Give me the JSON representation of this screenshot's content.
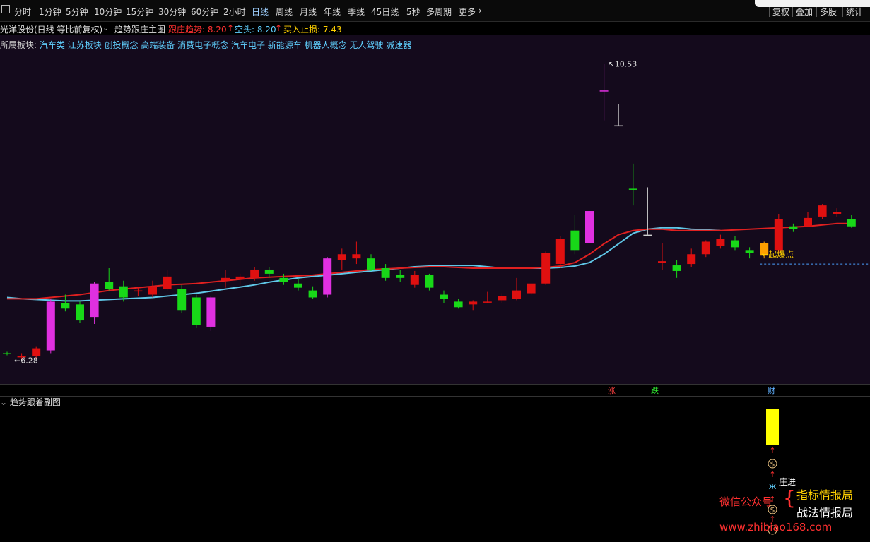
{
  "toolbar": {
    "items": [
      "分时",
      "1分钟",
      "5分钟",
      "10分钟",
      "15分钟",
      "30分钟",
      "60分钟",
      "2小时",
      "日线",
      "周线",
      "月线",
      "年线",
      "季线",
      "45日线",
      "5秒",
      "多周期",
      "更多"
    ],
    "active": "日线",
    "right": [
      "复权",
      "叠加",
      "多股",
      "统计"
    ]
  },
  "info": {
    "stock": "光洋股份(日线 等比前复权)",
    "indicator": "趋势跟庄主图",
    "trend_label": "跟庄趋势: 8.20",
    "short_label": "空头: 8.20",
    "stop_label": "买入止损: 7.43"
  },
  "sector": {
    "prefix": "所属板块:",
    "list": "汽车类 江苏板块 创投概念 高端装备 消费电子概念 汽车电子 新能源车 机器人概念 无人驾驶 减速器"
  },
  "annotations": {
    "high": "10.53",
    "low": "6.28",
    "breakout": "起爆点",
    "marker_up": "涨",
    "marker_down": "跌",
    "marker_cai": "财"
  },
  "sub": {
    "title": "趋势跟着副图",
    "zhuang": "庄进"
  },
  "watermark": {
    "wechat": "微信公众号",
    "line1": "指标情报局",
    "line2": "战法情报局",
    "url": "www.zhibiao168.com"
  },
  "chart_data": {
    "type": "candlestick",
    "yrange": [
      6.0,
      10.8
    ],
    "colors": {
      "up": "#e01010",
      "down": "#18d818",
      "special": "#e030e0",
      "trend": "#e02020",
      "short": "#60c8e8",
      "highlight": "#d0d0d0",
      "breakout": "#ffa000"
    },
    "candles": [
      {
        "o": 6.38,
        "h": 6.4,
        "l": 6.35,
        "c": 6.37,
        "k": "down"
      },
      {
        "o": 6.32,
        "h": 6.38,
        "l": 6.28,
        "c": 6.34,
        "k": "up"
      },
      {
        "o": 6.34,
        "h": 6.48,
        "l": 6.3,
        "c": 6.45,
        "k": "up"
      },
      {
        "o": 6.42,
        "h": 7.16,
        "l": 6.38,
        "c": 7.12,
        "k": "special"
      },
      {
        "o": 7.1,
        "h": 7.22,
        "l": 6.98,
        "c": 7.02,
        "k": "down"
      },
      {
        "o": 7.08,
        "h": 7.12,
        "l": 6.82,
        "c": 6.85,
        "k": "down"
      },
      {
        "o": 6.9,
        "h": 7.4,
        "l": 6.8,
        "c": 7.38,
        "k": "special"
      },
      {
        "o": 7.4,
        "h": 7.6,
        "l": 7.28,
        "c": 7.3,
        "k": "down"
      },
      {
        "o": 7.34,
        "h": 7.42,
        "l": 7.12,
        "c": 7.18,
        "k": "down"
      },
      {
        "o": 7.28,
        "h": 7.32,
        "l": 7.2,
        "c": 7.28,
        "k": "up"
      },
      {
        "o": 7.22,
        "h": 7.42,
        "l": 7.18,
        "c": 7.34,
        "k": "up"
      },
      {
        "o": 7.3,
        "h": 7.58,
        "l": 7.28,
        "c": 7.48,
        "k": "up"
      },
      {
        "o": 7.3,
        "h": 7.36,
        "l": 6.96,
        "c": 7.0,
        "k": "down"
      },
      {
        "o": 7.18,
        "h": 7.22,
        "l": 6.74,
        "c": 6.78,
        "k": "down"
      },
      {
        "o": 6.76,
        "h": 7.2,
        "l": 6.7,
        "c": 7.18,
        "k": "special"
      },
      {
        "o": 7.42,
        "h": 7.58,
        "l": 7.32,
        "c": 7.46,
        "k": "up"
      },
      {
        "o": 7.44,
        "h": 7.52,
        "l": 7.36,
        "c": 7.48,
        "k": "up"
      },
      {
        "o": 7.46,
        "h": 7.62,
        "l": 7.42,
        "c": 7.58,
        "k": "up"
      },
      {
        "o": 7.58,
        "h": 7.62,
        "l": 7.46,
        "c": 7.52,
        "k": "down"
      },
      {
        "o": 7.46,
        "h": 7.52,
        "l": 7.36,
        "c": 7.4,
        "k": "down"
      },
      {
        "o": 7.38,
        "h": 7.44,
        "l": 7.28,
        "c": 7.32,
        "k": "down"
      },
      {
        "o": 7.28,
        "h": 7.34,
        "l": 7.16,
        "c": 7.18,
        "k": "down"
      },
      {
        "o": 7.22,
        "h": 7.76,
        "l": 7.18,
        "c": 7.74,
        "k": "special"
      },
      {
        "o": 7.72,
        "h": 7.88,
        "l": 7.58,
        "c": 7.8,
        "k": "up"
      },
      {
        "o": 7.74,
        "h": 7.98,
        "l": 7.66,
        "c": 7.8,
        "k": "up"
      },
      {
        "o": 7.74,
        "h": 7.8,
        "l": 7.56,
        "c": 7.58,
        "k": "down"
      },
      {
        "o": 7.6,
        "h": 7.66,
        "l": 7.42,
        "c": 7.46,
        "k": "down"
      },
      {
        "o": 7.5,
        "h": 7.58,
        "l": 7.4,
        "c": 7.46,
        "k": "down"
      },
      {
        "o": 7.36,
        "h": 7.56,
        "l": 7.32,
        "c": 7.5,
        "k": "up"
      },
      {
        "o": 7.5,
        "h": 7.52,
        "l": 7.28,
        "c": 7.32,
        "k": "down"
      },
      {
        "o": 7.22,
        "h": 7.28,
        "l": 7.1,
        "c": 7.16,
        "k": "down"
      },
      {
        "o": 7.12,
        "h": 7.16,
        "l": 7.02,
        "c": 7.04,
        "k": "down"
      },
      {
        "o": 7.08,
        "h": 7.14,
        "l": 7.0,
        "c": 7.12,
        "k": "up"
      },
      {
        "o": 7.12,
        "h": 7.26,
        "l": 7.1,
        "c": 7.12,
        "k": "up"
      },
      {
        "o": 7.14,
        "h": 7.24,
        "l": 7.1,
        "c": 7.2,
        "k": "up"
      },
      {
        "o": 7.16,
        "h": 7.46,
        "l": 7.14,
        "c": 7.28,
        "k": "up"
      },
      {
        "o": 7.24,
        "h": 7.38,
        "l": 7.22,
        "c": 7.38,
        "k": "up"
      },
      {
        "o": 7.38,
        "h": 7.84,
        "l": 7.36,
        "c": 7.82,
        "k": "up"
      },
      {
        "o": 7.66,
        "h": 8.06,
        "l": 7.6,
        "c": 8.02,
        "k": "up"
      },
      {
        "o": 7.86,
        "h": 8.36,
        "l": 7.8,
        "c": 8.14,
        "k": "down"
      },
      {
        "o": 7.96,
        "h": 8.42,
        "l": 7.96,
        "c": 8.42,
        "k": "special"
      },
      {
        "o": 10.15,
        "h": 10.53,
        "l": 9.72,
        "c": 10.15,
        "k": "special"
      },
      {
        "o": 9.65,
        "h": 9.95,
        "l": 9.65,
        "c": 9.65,
        "k": "highlight"
      },
      {
        "o": 8.74,
        "h": 9.1,
        "l": 8.5,
        "c": 8.74,
        "k": "down"
      },
      {
        "o": 8.08,
        "h": 8.76,
        "l": 8.08,
        "c": 8.08,
        "k": "highlight"
      },
      {
        "o": 7.68,
        "h": 7.96,
        "l": 7.58,
        "c": 7.7,
        "k": "up"
      },
      {
        "o": 7.56,
        "h": 7.72,
        "l": 7.46,
        "c": 7.64,
        "k": "down"
      },
      {
        "o": 7.66,
        "h": 7.88,
        "l": 7.62,
        "c": 7.8,
        "k": "up"
      },
      {
        "o": 7.8,
        "h": 8.0,
        "l": 7.76,
        "c": 7.98,
        "k": "up"
      },
      {
        "o": 7.92,
        "h": 8.08,
        "l": 7.88,
        "c": 8.02,
        "k": "up"
      },
      {
        "o": 8.0,
        "h": 8.06,
        "l": 7.86,
        "c": 7.9,
        "k": "down"
      },
      {
        "o": 7.82,
        "h": 7.9,
        "l": 7.74,
        "c": 7.86,
        "k": "down"
      },
      {
        "o": 7.78,
        "h": 7.98,
        "l": 7.74,
        "c": 7.96,
        "k": "breakout"
      },
      {
        "o": 7.86,
        "h": 8.38,
        "l": 7.82,
        "c": 8.3,
        "k": "up"
      },
      {
        "o": 8.16,
        "h": 8.24,
        "l": 8.12,
        "c": 8.2,
        "k": "down"
      },
      {
        "o": 8.2,
        "h": 8.4,
        "l": 8.2,
        "c": 8.32,
        "k": "up"
      },
      {
        "o": 8.34,
        "h": 8.52,
        "l": 8.3,
        "c": 8.5,
        "k": "up"
      },
      {
        "o": 8.38,
        "h": 8.46,
        "l": 8.34,
        "c": 8.4,
        "k": "up"
      },
      {
        "o": 8.3,
        "h": 8.36,
        "l": 8.18,
        "c": 8.2,
        "k": "down"
      }
    ],
    "trend_line": [
      7.16,
      7.16,
      7.16,
      7.18,
      7.2,
      7.22,
      7.25,
      7.28,
      7.3,
      7.32,
      7.34,
      7.36,
      7.37,
      7.38,
      7.4,
      7.42,
      7.44,
      7.46,
      7.47,
      7.48,
      7.49,
      7.5,
      7.52,
      7.54,
      7.56,
      7.58,
      7.59,
      7.6,
      7.61,
      7.62,
      7.62,
      7.61,
      7.6,
      7.6,
      7.6,
      7.6,
      7.6,
      7.61,
      7.63,
      7.68,
      7.8,
      7.95,
      8.08,
      8.14,
      8.16,
      8.16,
      8.14,
      8.14,
      8.14,
      8.14,
      8.15,
      8.16,
      8.17,
      8.18,
      8.19,
      8.2,
      8.22,
      8.24,
      8.24
    ],
    "short_line": [
      7.18,
      7.16,
      7.15,
      7.14,
      7.13,
      7.13,
      7.14,
      7.15,
      7.16,
      7.17,
      7.18,
      7.2,
      7.22,
      7.24,
      7.27,
      7.3,
      7.33,
      7.36,
      7.4,
      7.43,
      7.46,
      7.48,
      7.5,
      7.52,
      7.54,
      7.56,
      7.58,
      7.6,
      7.62,
      7.63,
      7.64,
      7.64,
      7.64,
      7.62,
      7.6,
      7.6,
      7.6,
      7.6,
      7.61,
      7.63,
      7.68,
      7.8,
      7.95,
      8.1,
      8.16,
      8.18,
      8.18,
      8.16,
      8.15,
      8.14
    ],
    "breakout_level": 7.66
  }
}
